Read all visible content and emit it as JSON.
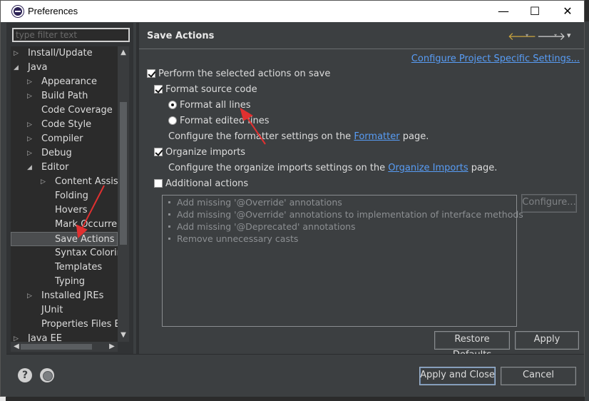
{
  "window": {
    "title": "Preferences",
    "minimize_glyph": "—",
    "maximize_glyph": "☐",
    "close_glyph": "✕"
  },
  "filter": {
    "placeholder": "type filter text"
  },
  "tree": {
    "items": [
      {
        "label": "Install/Update",
        "expander": "▷"
      },
      {
        "label": "Java",
        "expander": "◢"
      },
      {
        "label": "Appearance",
        "expander": "▷"
      },
      {
        "label": "Build Path",
        "expander": "▷"
      },
      {
        "label": "Code Coverage",
        "expander": ""
      },
      {
        "label": "Code Style",
        "expander": "▷"
      },
      {
        "label": "Compiler",
        "expander": "▷"
      },
      {
        "label": "Debug",
        "expander": "▷"
      },
      {
        "label": "Editor",
        "expander": "◢"
      },
      {
        "label": "Content Assist",
        "expander": "▷"
      },
      {
        "label": "Folding",
        "expander": ""
      },
      {
        "label": "Hovers",
        "expander": ""
      },
      {
        "label": "Mark Occurrences",
        "expander": ""
      },
      {
        "label": "Save Actions",
        "expander": ""
      },
      {
        "label": "Syntax Coloring",
        "expander": ""
      },
      {
        "label": "Templates",
        "expander": ""
      },
      {
        "label": "Typing",
        "expander": ""
      },
      {
        "label": "Installed JREs",
        "expander": "▷"
      },
      {
        "label": "JUnit",
        "expander": ""
      },
      {
        "label": "Properties Files Editor",
        "expander": ""
      },
      {
        "label": "Java EE",
        "expander": "▷"
      }
    ],
    "selected": "Save Actions",
    "scroll_up": "▲",
    "scroll_down": "▼",
    "scroll_left": "◀",
    "scroll_right": "▶"
  },
  "page": {
    "title": "Save Actions",
    "back_icon": "🡐",
    "forward_icon": "🡒",
    "menu_icon": "▾",
    "project_link": "Configure Project Specific Settings...",
    "perform_on_save": "Perform the selected actions on save",
    "format_source": "Format source code",
    "format_all_lines": "Format all lines",
    "format_edited_lines": "Format edited lines",
    "formatter_text_before": "Configure the formatter settings on the ",
    "formatter_link": "Formatter",
    "formatter_text_after": " page.",
    "organize_imports": "Organize imports",
    "organize_text_before": "Configure the organize imports settings on the ",
    "organize_link": "Organize Imports",
    "organize_text_after": " page.",
    "additional_actions": "Additional actions",
    "additional_items": [
      "Add missing '@Override' annotations",
      "Add missing '@Override' annotations to implementation of interface methods",
      "Add missing '@Deprecated' annotations",
      "Remove unnecessary casts"
    ],
    "configure_button": "Configure...",
    "restore_defaults": "Restore Defaults",
    "apply": "Apply"
  },
  "footer": {
    "help_icon": "?",
    "apply_and_close": "Apply and Close",
    "cancel": "Cancel"
  },
  "colors": {
    "background": "#3c3f41",
    "link": "#589df6",
    "annotation_arrow": "#e03030"
  }
}
